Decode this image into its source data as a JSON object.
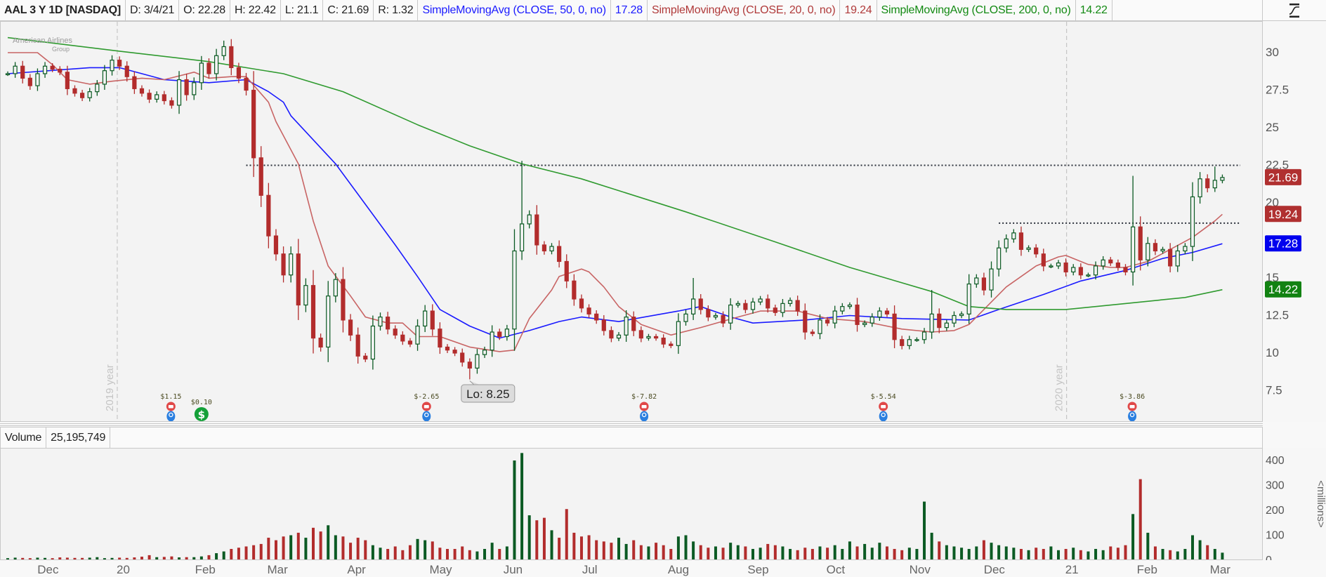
{
  "header": {
    "symbol": "AAL 3 Y 1D [NASDAQ]",
    "date": "D: 3/4/21",
    "open": "O: 22.28",
    "high": "H: 22.42",
    "low": "L: 21.1",
    "close": "C: 21.69",
    "range": "R: 1.32",
    "studies": [
      {
        "label": "SimpleMovingAvg (CLOSE, 50, 0, no)",
        "value": "17.28",
        "color": "#1a1aff"
      },
      {
        "label": "SimpleMovingAvg (CLOSE, 20, 0, no)",
        "value": "19.24",
        "color": "#b03a3a"
      },
      {
        "label": "SimpleMovingAvg (CLOSE, 200, 0, no)",
        "value": "14.22",
        "color": "#138a13"
      }
    ]
  },
  "logo": {
    "line1": "American Airlines",
    "line2": "Group"
  },
  "volume_header": {
    "label": "Volume",
    "value": "25,195,749"
  },
  "chart_data": {
    "type": "candlestick",
    "title": "AAL 3 Y 1D [NASDAQ]",
    "colors": {
      "up": "#0b5a23",
      "down": "#b22c2c",
      "sma50": "#1a1aff",
      "sma20": "#c86464",
      "sma200": "#2f9a2f"
    },
    "closes": [
      28.6,
      29.1,
      28.3,
      27.8,
      28.6,
      29.1,
      28.9,
      28.7,
      27.6,
      27.3,
      27.0,
      27.4,
      27.9,
      28.8,
      29.5,
      29.1,
      28.4,
      27.6,
      27.3,
      26.9,
      27.2,
      26.8,
      26.5,
      28.2,
      27.2,
      28.0,
      29.3,
      28.6,
      29.8,
      30.4,
      29.0,
      28.3,
      27.5,
      23.0,
      20.5,
      17.8,
      16.6,
      15.2,
      16.6,
      13.2,
      14.5,
      11.0,
      10.4,
      13.8,
      14.9,
      12.2,
      11.2,
      9.8,
      9.6,
      11.8,
      12.4,
      11.6,
      11.2,
      10.8,
      10.6,
      11.8,
      12.8,
      11.6,
      10.4,
      10.2,
      10.0,
      9.4,
      9.0,
      9.9,
      10.2,
      11.4,
      11.1,
      11.6,
      16.8,
      18.6,
      19.2,
      17.2,
      16.8,
      17.1,
      16.1,
      14.8,
      13.6,
      13.0,
      12.6,
      12.2,
      11.5,
      11.0,
      11.2,
      12.4,
      11.5,
      11.0,
      11.1,
      11.0,
      10.6,
      10.5,
      12.1,
      12.6,
      13.6,
      12.9,
      12.4,
      12.5,
      12.0,
      13.2,
      13.3,
      12.9,
      13.4,
      13.6,
      13.0,
      12.7,
      13.3,
      13.5,
      12.8,
      11.4,
      11.3,
      12.2,
      12.0,
      12.8,
      13.1,
      13.2,
      11.9,
      12.0,
      12.4,
      12.8,
      12.6,
      10.9,
      10.5,
      10.9,
      10.9,
      11.4,
      12.6,
      11.7,
      12.0,
      12.5,
      12.6,
      14.6,
      15.0,
      14.2,
      15.6,
      17.0,
      17.6,
      18.0,
      16.9,
      17.0,
      16.6,
      15.8,
      15.8,
      16.0,
      15.4,
      15.7,
      15.2,
      15.2,
      15.8,
      16.2,
      16.0,
      15.7,
      15.4,
      18.4,
      16.2,
      17.3,
      16.8,
      16.9,
      15.8,
      16.8,
      17.1,
      20.4,
      21.6,
      21.0,
      21.5,
      21.69
    ],
    "extremes": [
      {
        "index": 29,
        "high": 30.8
      },
      {
        "index": 69,
        "high": 22.8
      },
      {
        "index": 62,
        "low": 8.25
      },
      {
        "index": 92,
        "high": 15.0
      },
      {
        "index": 124,
        "high": 14.2
      },
      {
        "index": 151,
        "high": 21.8
      },
      {
        "index": 162,
        "high": 22.42
      }
    ],
    "volume_millions": [
      8,
      10,
      9,
      8,
      10,
      9,
      8,
      11,
      10,
      9,
      9,
      10,
      12,
      8,
      9,
      10,
      9,
      11,
      14,
      20,
      12,
      13,
      15,
      11,
      12,
      12,
      15,
      20,
      28,
      35,
      45,
      50,
      55,
      60,
      65,
      90,
      80,
      95,
      100,
      110,
      90,
      130,
      115,
      140,
      100,
      95,
      70,
      90,
      80,
      60,
      50,
      45,
      55,
      40,
      60,
      85,
      80,
      75,
      50,
      45,
      45,
      55,
      40,
      35,
      45,
      70,
      45,
      55,
      400,
      430,
      180,
      160,
      170,
      120,
      90,
      205,
      110,
      95,
      100,
      80,
      75,
      70,
      90,
      65,
      80,
      60,
      55,
      70,
      60,
      45,
      95,
      100,
      75,
      60,
      50,
      55,
      50,
      70,
      60,
      55,
      45,
      50,
      65,
      60,
      55,
      45,
      40,
      50,
      45,
      55,
      50,
      60,
      45,
      75,
      55,
      65,
      50,
      70,
      55,
      45,
      40,
      50,
      45,
      235,
      110,
      75,
      60,
      55,
      50,
      45,
      55,
      80,
      70,
      60,
      55,
      50,
      45,
      40,
      50,
      45,
      55,
      40,
      45,
      50,
      40,
      35,
      45,
      40,
      55,
      50,
      60,
      185,
      325,
      110,
      55,
      45,
      40,
      35,
      45,
      100,
      80,
      60,
      45,
      30
    ],
    "sma": [
      {
        "name": "SMA 50",
        "key": "sma50",
        "points": [
          [
            0,
            28.6
          ],
          [
            11,
            29.0
          ],
          [
            15,
            29.0
          ],
          [
            21,
            28.2
          ],
          [
            27,
            28.0
          ],
          [
            32,
            28.2
          ],
          [
            35,
            27.4
          ],
          [
            37,
            26.7
          ],
          [
            38,
            25.8
          ],
          [
            44,
            22.6
          ],
          [
            48,
            19.9
          ],
          [
            52,
            17.2
          ],
          [
            55,
            15.1
          ],
          [
            58,
            12.9
          ],
          [
            62,
            11.8
          ],
          [
            66,
            11.0
          ],
          [
            70,
            11.5
          ],
          [
            74,
            12.1
          ],
          [
            77,
            12.4
          ],
          [
            82,
            12.1
          ],
          [
            90,
            12.8
          ],
          [
            93,
            13.1
          ],
          [
            97,
            12.4
          ],
          [
            100,
            12.0
          ],
          [
            107,
            12.2
          ],
          [
            113,
            12.5
          ],
          [
            120,
            12.3
          ],
          [
            129,
            12.2
          ],
          [
            133,
            12.9
          ],
          [
            139,
            13.9
          ],
          [
            144,
            14.8
          ],
          [
            150,
            15.5
          ],
          [
            155,
            16.3
          ],
          [
            159,
            16.7
          ],
          [
            163,
            17.28
          ]
        ]
      },
      {
        "name": "SMA 20",
        "key": "sma20",
        "points": [
          [
            0,
            30.0
          ],
          [
            4,
            30.0
          ],
          [
            6,
            29.2
          ],
          [
            8,
            28.2
          ],
          [
            11,
            27.9
          ],
          [
            14,
            28.1
          ],
          [
            18,
            28.3
          ],
          [
            21,
            28.2
          ],
          [
            25,
            28.7
          ],
          [
            27,
            28.3
          ],
          [
            30,
            28.4
          ],
          [
            32,
            28.4
          ],
          [
            35,
            26.7
          ],
          [
            36,
            25.4
          ],
          [
            39,
            22.6
          ],
          [
            41,
            18.8
          ],
          [
            43,
            15.8
          ],
          [
            46,
            13.8
          ],
          [
            48,
            12.4
          ],
          [
            51,
            12.0
          ],
          [
            53,
            12.0
          ],
          [
            55,
            11.1
          ],
          [
            58,
            11.1
          ],
          [
            62,
            10.4
          ],
          [
            66,
            10.1
          ],
          [
            68,
            10.2
          ],
          [
            70,
            12.3
          ],
          [
            73,
            14.2
          ],
          [
            74,
            15.1
          ],
          [
            77,
            15.6
          ],
          [
            78,
            15.4
          ],
          [
            80,
            14.4
          ],
          [
            82,
            13.1
          ],
          [
            85,
            11.9
          ],
          [
            89,
            11.2
          ],
          [
            93,
            11.7
          ],
          [
            98,
            12.4
          ],
          [
            101,
            12.8
          ],
          [
            106,
            12.8
          ],
          [
            110,
            12.3
          ],
          [
            115,
            12.1
          ],
          [
            120,
            11.6
          ],
          [
            124,
            11.4
          ],
          [
            127,
            11.5
          ],
          [
            129,
            11.9
          ],
          [
            131,
            12.9
          ],
          [
            134,
            14.4
          ],
          [
            138,
            15.8
          ],
          [
            141,
            16.4
          ],
          [
            142,
            16.5
          ],
          [
            145,
            15.9
          ],
          [
            148,
            15.7
          ],
          [
            150,
            15.7
          ],
          [
            153,
            16.1
          ],
          [
            156,
            16.9
          ],
          [
            159,
            17.7
          ],
          [
            162,
            18.8
          ],
          [
            163,
            19.24
          ]
        ]
      },
      {
        "name": "SMA 200",
        "key": "sma200",
        "points": [
          [
            0,
            31.0
          ],
          [
            15,
            30.1
          ],
          [
            27,
            29.4
          ],
          [
            37,
            28.6
          ],
          [
            45,
            27.4
          ],
          [
            55,
            25.2
          ],
          [
            62,
            23.8
          ],
          [
            69,
            22.6
          ],
          [
            77,
            21.6
          ],
          [
            91,
            19.4
          ],
          [
            103,
            17.4
          ],
          [
            113,
            15.7
          ],
          [
            124,
            14.1
          ],
          [
            129,
            13.1
          ],
          [
            134,
            12.9
          ],
          [
            142,
            12.9
          ],
          [
            150,
            13.3
          ],
          [
            158,
            13.7
          ],
          [
            163,
            14.22
          ]
        ]
      }
    ],
    "price_axis": {
      "ticks": [
        30,
        27.5,
        25,
        22.5,
        20,
        15,
        12.5,
        10,
        7.5
      ],
      "range": [
        5.5,
        31.5
      ]
    },
    "volume_axis": {
      "ticks": [
        400,
        300,
        200,
        100,
        0
      ],
      "unit": "<millions>"
    },
    "x_ticks": [
      {
        "label": "Dec",
        "index": 5.5
      },
      {
        "label": "20",
        "index": 15.6
      },
      {
        "label": "Feb",
        "index": 26.6
      },
      {
        "label": "Mar",
        "index": 36.3
      },
      {
        "label": "Apr",
        "index": 46.9
      },
      {
        "label": "May",
        "index": 58.2
      },
      {
        "label": "Jun",
        "index": 67.9
      },
      {
        "label": "Jul",
        "index": 78.2
      },
      {
        "label": "Aug",
        "index": 90.1
      },
      {
        "label": "Sep",
        "index": 100.8
      },
      {
        "label": "Oct",
        "index": 111.2
      },
      {
        "label": "Nov",
        "index": 122.5
      },
      {
        "label": "Dec",
        "index": 132.5
      },
      {
        "label": "21",
        "index": 142.9
      },
      {
        "label": "Feb",
        "index": 153
      },
      {
        "label": "Mar",
        "index": 162.8
      }
    ],
    "resistance_lines": [
      {
        "value": 22.5,
        "start_index": 32
      },
      {
        "value": 18.65,
        "start_index": 133
      }
    ],
    "year_markers": [
      {
        "index": 14.7,
        "label": "2019 year"
      },
      {
        "index": 142.1,
        "label": "2020 year"
      }
    ],
    "events": [
      {
        "index": 21.9,
        "label": "$1.15",
        "type": "earnings"
      },
      {
        "index": 26,
        "label": "$0.10",
        "type": "dividend"
      },
      {
        "index": 56.2,
        "label": "$-2.65",
        "type": "earnings"
      },
      {
        "index": 85.4,
        "label": "$-7.82",
        "type": "earnings"
      },
      {
        "index": 117.5,
        "label": "$-5.54",
        "type": "earnings"
      },
      {
        "index": 150.9,
        "label": "$-3.86",
        "type": "earnings"
      }
    ],
    "low_annotation": {
      "index": 62,
      "value": 8.25,
      "label": "Lo: 8.25"
    },
    "tags": [
      {
        "value": 21.69,
        "label": "21.69",
        "color": "#b03030"
      },
      {
        "value": 19.24,
        "label": "19.24",
        "color": "#b03030"
      },
      {
        "value": 17.28,
        "label": "17.28",
        "color": "#0000ee"
      },
      {
        "value": 14.22,
        "label": "14.22",
        "color": "#128212"
      }
    ]
  }
}
